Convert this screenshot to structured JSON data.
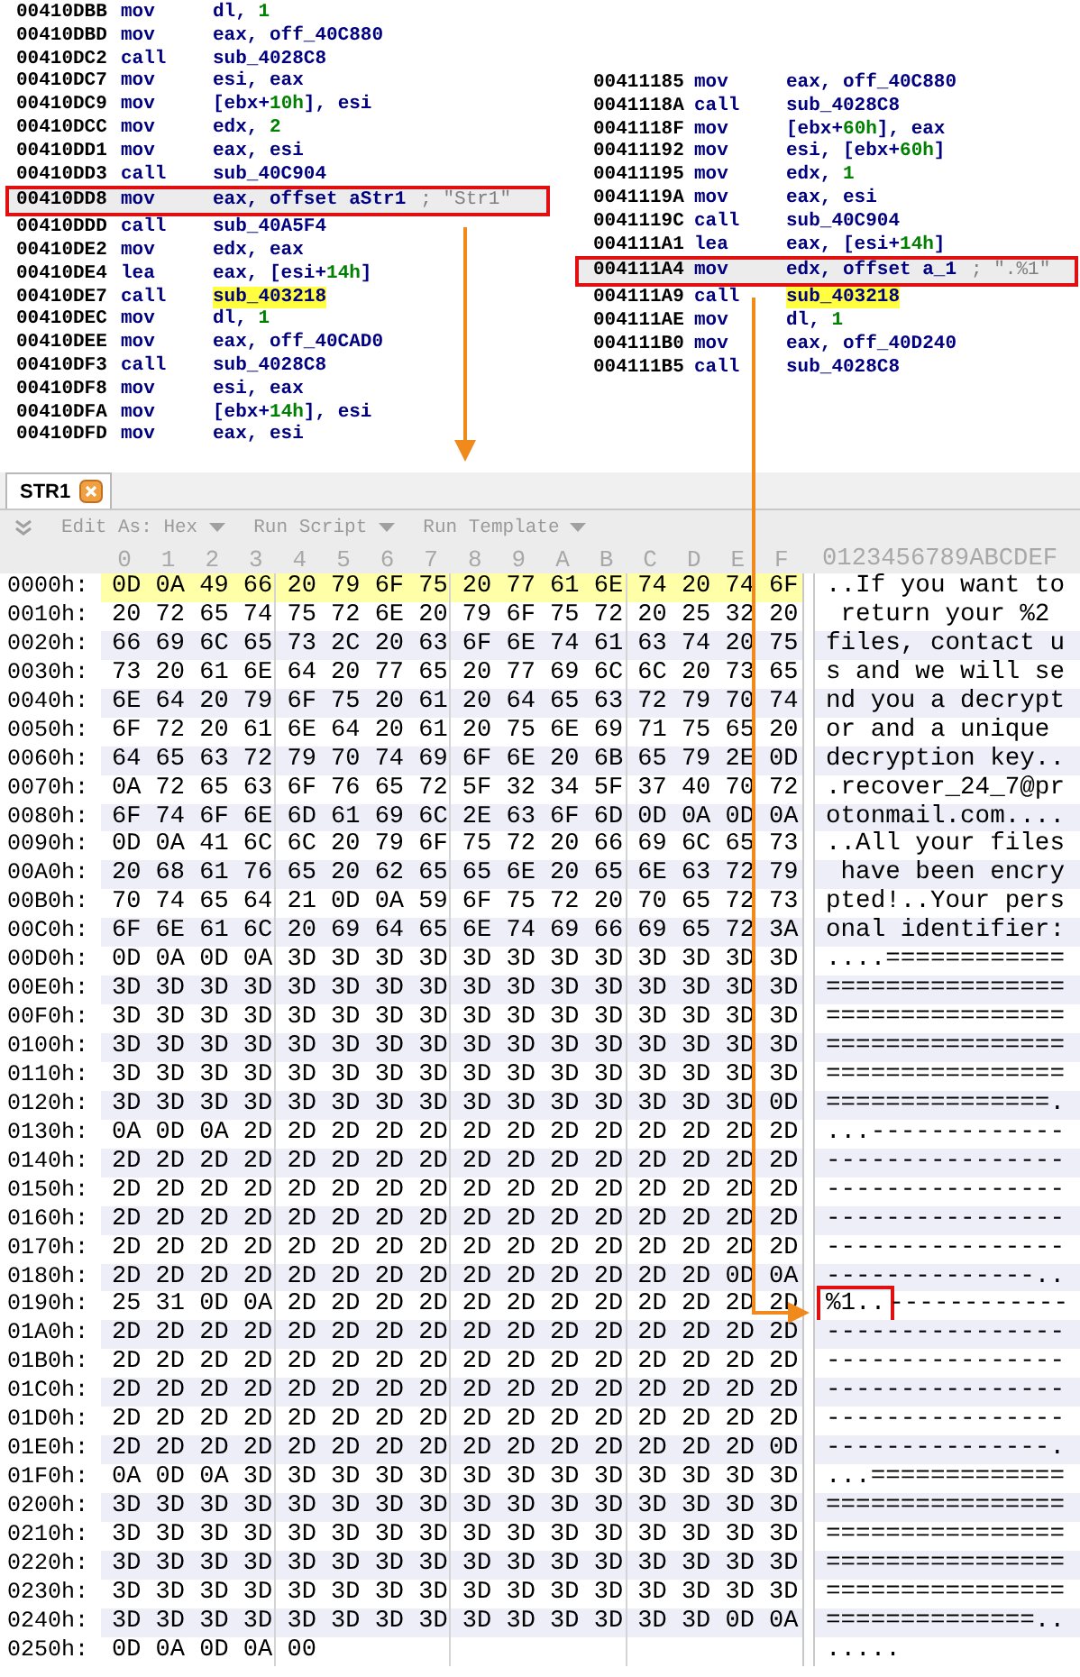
{
  "disassembly_left": {
    "lines": [
      {
        "address": "00410DBB",
        "mnemonic": "mov",
        "operands": [
          {
            "text": "dl, "
          },
          {
            "text": "1",
            "kind": "number"
          }
        ]
      },
      {
        "address": "00410DBD",
        "mnemonic": "mov",
        "operands": [
          {
            "text": "eax, off_40C880"
          }
        ]
      },
      {
        "address": "00410DC2",
        "mnemonic": "call",
        "operands": [
          {
            "text": "sub_4028C8"
          }
        ]
      },
      {
        "address": "00410DC7",
        "mnemonic": "mov",
        "operands": [
          {
            "text": "esi, eax"
          }
        ]
      },
      {
        "address": "00410DC9",
        "mnemonic": "mov",
        "operands": [
          {
            "text": "[ebx+"
          },
          {
            "text": "10h",
            "kind": "number"
          },
          {
            "text": "], esi"
          }
        ]
      },
      {
        "address": "00410DCC",
        "mnemonic": "mov",
        "operands": [
          {
            "text": "edx, "
          },
          {
            "text": "2",
            "kind": "number"
          }
        ]
      },
      {
        "address": "00410DD1",
        "mnemonic": "mov",
        "operands": [
          {
            "text": "eax, esi"
          }
        ]
      },
      {
        "address": "00410DD3",
        "mnemonic": "call",
        "operands": [
          {
            "text": "sub_40C904"
          }
        ]
      },
      {
        "address": "00410DD8",
        "mnemonic": "mov",
        "operands": [
          {
            "text": "eax, offset aStr1"
          }
        ],
        "comment": "; \"Str1\"",
        "boxed": true
      },
      {
        "address": "00410DDD",
        "mnemonic": "call",
        "operands": [
          {
            "text": "sub_40A5F4"
          }
        ]
      },
      {
        "address": "00410DE2",
        "mnemonic": "mov",
        "operands": [
          {
            "text": "edx, eax"
          }
        ]
      },
      {
        "address": "00410DE4",
        "mnemonic": "lea",
        "operands": [
          {
            "text": "eax, [esi+"
          },
          {
            "text": "14h",
            "kind": "number"
          },
          {
            "text": "]"
          }
        ]
      },
      {
        "address": "00410DE7",
        "mnemonic": "call",
        "operands": [
          {
            "text": "sub_403218",
            "kind": "highlight"
          }
        ]
      },
      {
        "address": "00410DEC",
        "mnemonic": "mov",
        "operands": [
          {
            "text": "dl, "
          },
          {
            "text": "1",
            "kind": "number"
          }
        ]
      },
      {
        "address": "00410DEE",
        "mnemonic": "mov",
        "operands": [
          {
            "text": "eax, off_40CAD0"
          }
        ]
      },
      {
        "address": "00410DF3",
        "mnemonic": "call",
        "operands": [
          {
            "text": "sub_4028C8"
          }
        ]
      },
      {
        "address": "00410DF8",
        "mnemonic": "mov",
        "operands": [
          {
            "text": "esi, eax"
          }
        ]
      },
      {
        "address": "00410DFA",
        "mnemonic": "mov",
        "operands": [
          {
            "text": "[ebx+"
          },
          {
            "text": "14h",
            "kind": "number"
          },
          {
            "text": "], esi"
          }
        ]
      },
      {
        "address": "00410DFD",
        "mnemonic": "mov",
        "operands": [
          {
            "text": "eax, esi"
          }
        ]
      }
    ]
  },
  "disassembly_right": {
    "lines": [
      {
        "address": "00411185",
        "mnemonic": "mov",
        "operands": [
          {
            "text": "eax, off_40C880"
          }
        ]
      },
      {
        "address": "0041118A",
        "mnemonic": "call",
        "operands": [
          {
            "text": "sub_4028C8"
          }
        ]
      },
      {
        "address": "0041118F",
        "mnemonic": "mov",
        "operands": [
          {
            "text": "[ebx+"
          },
          {
            "text": "60h",
            "kind": "number"
          },
          {
            "text": "], eax"
          }
        ]
      },
      {
        "address": "00411192",
        "mnemonic": "mov",
        "operands": [
          {
            "text": "esi, [ebx+"
          },
          {
            "text": "60h",
            "kind": "number"
          },
          {
            "text": "]"
          }
        ]
      },
      {
        "address": "00411195",
        "mnemonic": "mov",
        "operands": [
          {
            "text": "edx, "
          },
          {
            "text": "1",
            "kind": "number"
          }
        ]
      },
      {
        "address": "0041119A",
        "mnemonic": "mov",
        "operands": [
          {
            "text": "eax, esi"
          }
        ]
      },
      {
        "address": "0041119C",
        "mnemonic": "call",
        "operands": [
          {
            "text": "sub_40C904"
          }
        ]
      },
      {
        "address": "004111A1",
        "mnemonic": "lea",
        "operands": [
          {
            "text": "eax, [esi+"
          },
          {
            "text": "14h",
            "kind": "number"
          },
          {
            "text": "]"
          }
        ]
      },
      {
        "address": "004111A4",
        "mnemonic": "mov",
        "operands": [
          {
            "text": "edx, offset a_1"
          }
        ],
        "comment": "; \".%1\"",
        "boxed": true
      },
      {
        "address": "004111A9",
        "mnemonic": "call",
        "operands": [
          {
            "text": "sub_403218",
            "kind": "highlight"
          }
        ]
      },
      {
        "address": "004111AE",
        "mnemonic": "mov",
        "operands": [
          {
            "text": "dl, "
          },
          {
            "text": "1",
            "kind": "number"
          }
        ]
      },
      {
        "address": "004111B0",
        "mnemonic": "mov",
        "operands": [
          {
            "text": "eax, off_40D240"
          }
        ]
      },
      {
        "address": "004111B5",
        "mnemonic": "call",
        "operands": [
          {
            "text": "sub_4028C8"
          }
        ]
      }
    ]
  },
  "hex_editor": {
    "tab": {
      "label": "STR1",
      "selected": true
    },
    "toolbar": [
      {
        "label": "Edit As: Hex"
      },
      {
        "label": "Run Script"
      },
      {
        "label": "Run Template"
      }
    ],
    "column_header": [
      "0",
      "1",
      "2",
      "3",
      "4",
      "5",
      "6",
      "7",
      "8",
      "9",
      "A",
      "B",
      "C",
      "D",
      "E",
      "F"
    ],
    "ascii_header": "0123456789ABCDEF",
    "rows": [
      {
        "offset": "0000h:",
        "bytes": "0D 0A 49 66 20 79 6F 75 20 77 61 6E 74 20 74 6F",
        "ascii": "..If you want to",
        "selected": true
      },
      {
        "offset": "0010h:",
        "bytes": "20 72 65 74 75 72 6E 20 79 6F 75 72 20 25 32 20",
        "ascii": " return your %2 ",
        "selected": false
      },
      {
        "offset": "0020h:",
        "bytes": "66 69 6C 65 73 2C 20 63 6F 6E 74 61 63 74 20 75",
        "ascii": "files, contact u",
        "selected": false
      },
      {
        "offset": "0030h:",
        "bytes": "73 20 61 6E 64 20 77 65 20 77 69 6C 6C 20 73 65",
        "ascii": "s and we will se",
        "selected": false
      },
      {
        "offset": "0040h:",
        "bytes": "6E 64 20 79 6F 75 20 61 20 64 65 63 72 79 70 74",
        "ascii": "nd you a decrypt",
        "selected": false
      },
      {
        "offset": "0050h:",
        "bytes": "6F 72 20 61 6E 64 20 61 20 75 6E 69 71 75 65 20",
        "ascii": "or and a unique ",
        "selected": false
      },
      {
        "offset": "0060h:",
        "bytes": "64 65 63 72 79 70 74 69 6F 6E 20 6B 65 79 2E 0D",
        "ascii": "decryption key..",
        "selected": false
      },
      {
        "offset": "0070h:",
        "bytes": "0A 72 65 63 6F 76 65 72 5F 32 34 5F 37 40 70 72",
        "ascii": ".recover_24_7@pr",
        "selected": false
      },
      {
        "offset": "0080h:",
        "bytes": "6F 74 6F 6E 6D 61 69 6C 2E 63 6F 6D 0D 0A 0D 0A",
        "ascii": "otonmail.com....",
        "selected": false
      },
      {
        "offset": "0090h:",
        "bytes": "0D 0A 41 6C 6C 20 79 6F 75 72 20 66 69 6C 65 73",
        "ascii": "..All your files",
        "selected": false
      },
      {
        "offset": "00A0h:",
        "bytes": "20 68 61 76 65 20 62 65 65 6E 20 65 6E 63 72 79",
        "ascii": " have been encry",
        "selected": false
      },
      {
        "offset": "00B0h:",
        "bytes": "70 74 65 64 21 0D 0A 59 6F 75 72 20 70 65 72 73",
        "ascii": "pted!..Your pers",
        "selected": false
      },
      {
        "offset": "00C0h:",
        "bytes": "6F 6E 61 6C 20 69 64 65 6E 74 69 66 69 65 72 3A",
        "ascii": "onal identifier:",
        "selected": false
      },
      {
        "offset": "00D0h:",
        "bytes": "0D 0A 0D 0A 3D 3D 3D 3D 3D 3D 3D 3D 3D 3D 3D 3D",
        "ascii": "....============",
        "selected": false
      },
      {
        "offset": "00E0h:",
        "bytes": "3D 3D 3D 3D 3D 3D 3D 3D 3D 3D 3D 3D 3D 3D 3D 3D",
        "ascii": "================",
        "selected": false
      },
      {
        "offset": "00F0h:",
        "bytes": "3D 3D 3D 3D 3D 3D 3D 3D 3D 3D 3D 3D 3D 3D 3D 3D",
        "ascii": "================",
        "selected": false
      },
      {
        "offset": "0100h:",
        "bytes": "3D 3D 3D 3D 3D 3D 3D 3D 3D 3D 3D 3D 3D 3D 3D 3D",
        "ascii": "================",
        "selected": false
      },
      {
        "offset": "0110h:",
        "bytes": "3D 3D 3D 3D 3D 3D 3D 3D 3D 3D 3D 3D 3D 3D 3D 3D",
        "ascii": "================",
        "selected": false
      },
      {
        "offset": "0120h:",
        "bytes": "3D 3D 3D 3D 3D 3D 3D 3D 3D 3D 3D 3D 3D 3D 3D 0D",
        "ascii": "===============.",
        "selected": false
      },
      {
        "offset": "0130h:",
        "bytes": "0A 0D 0A 2D 2D 2D 2D 2D 2D 2D 2D 2D 2D 2D 2D 2D",
        "ascii": "...-------------",
        "selected": false
      },
      {
        "offset": "0140h:",
        "bytes": "2D 2D 2D 2D 2D 2D 2D 2D 2D 2D 2D 2D 2D 2D 2D 2D",
        "ascii": "----------------",
        "selected": false
      },
      {
        "offset": "0150h:",
        "bytes": "2D 2D 2D 2D 2D 2D 2D 2D 2D 2D 2D 2D 2D 2D 2D 2D",
        "ascii": "----------------",
        "selected": false
      },
      {
        "offset": "0160h:",
        "bytes": "2D 2D 2D 2D 2D 2D 2D 2D 2D 2D 2D 2D 2D 2D 2D 2D",
        "ascii": "----------------",
        "selected": false
      },
      {
        "offset": "0170h:",
        "bytes": "2D 2D 2D 2D 2D 2D 2D 2D 2D 2D 2D 2D 2D 2D 2D 2D",
        "ascii": "----------------",
        "selected": false
      },
      {
        "offset": "0180h:",
        "bytes": "2D 2D 2D 2D 2D 2D 2D 2D 2D 2D 2D 2D 2D 2D 0D 0A",
        "ascii": "--------------..",
        "selected": false
      },
      {
        "offset": "0190h:",
        "bytes": "25 31 0D 0A 2D 2D 2D 2D 2D 2D 2D 2D 2D 2D 2D 2D",
        "callout": "%1..",
        "ascii": "------------",
        "selected": false
      },
      {
        "offset": "01A0h:",
        "bytes": "2D 2D 2D 2D 2D 2D 2D 2D 2D 2D 2D 2D 2D 2D 2D 2D",
        "ascii": "----------------",
        "selected": false
      },
      {
        "offset": "01B0h:",
        "bytes": "2D 2D 2D 2D 2D 2D 2D 2D 2D 2D 2D 2D 2D 2D 2D 2D",
        "ascii": "----------------",
        "selected": false
      },
      {
        "offset": "01C0h:",
        "bytes": "2D 2D 2D 2D 2D 2D 2D 2D 2D 2D 2D 2D 2D 2D 2D 2D",
        "ascii": "----------------",
        "selected": false
      },
      {
        "offset": "01D0h:",
        "bytes": "2D 2D 2D 2D 2D 2D 2D 2D 2D 2D 2D 2D 2D 2D 2D 2D",
        "ascii": "----------------",
        "selected": false
      },
      {
        "offset": "01E0h:",
        "bytes": "2D 2D 2D 2D 2D 2D 2D 2D 2D 2D 2D 2D 2D 2D 2D 0D",
        "ascii": "---------------.",
        "selected": false
      },
      {
        "offset": "01F0h:",
        "bytes": "0A 0D 0A 3D 3D 3D 3D 3D 3D 3D 3D 3D 3D 3D 3D 3D",
        "ascii": "...=============",
        "selected": false
      },
      {
        "offset": "0200h:",
        "bytes": "3D 3D 3D 3D 3D 3D 3D 3D 3D 3D 3D 3D 3D 3D 3D 3D",
        "ascii": "================",
        "selected": false
      },
      {
        "offset": "0210h:",
        "bytes": "3D 3D 3D 3D 3D 3D 3D 3D 3D 3D 3D 3D 3D 3D 3D 3D",
        "ascii": "================",
        "selected": false
      },
      {
        "offset": "0220h:",
        "bytes": "3D 3D 3D 3D 3D 3D 3D 3D 3D 3D 3D 3D 3D 3D 3D 3D",
        "ascii": "================",
        "selected": false
      },
      {
        "offset": "0230h:",
        "bytes": "3D 3D 3D 3D 3D 3D 3D 3D 3D 3D 3D 3D 3D 3D 3D 3D",
        "ascii": "================",
        "selected": false
      },
      {
        "offset": "0240h:",
        "bytes": "3D 3D 3D 3D 3D 3D 3D 3D 3D 3D 3D 3D 3D 3D 0D 0A",
        "ascii": "==============..",
        "selected": false
      },
      {
        "offset": "0250h:",
        "bytes": "0D 0A 0D 0A 00",
        "ascii": ".....",
        "selected": false
      }
    ]
  }
}
